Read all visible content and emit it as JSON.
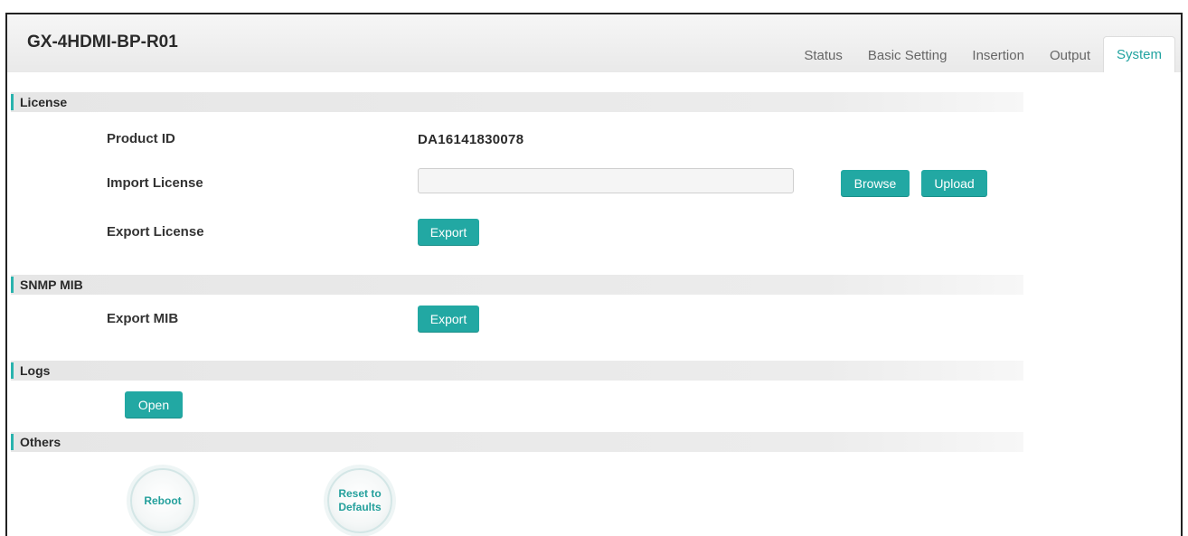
{
  "header": {
    "device_title": "GX-4HDMI-BP-R01",
    "tabs": [
      {
        "label": "Status",
        "active": false
      },
      {
        "label": "Basic Setting",
        "active": false
      },
      {
        "label": "Insertion",
        "active": false
      },
      {
        "label": "Output",
        "active": false
      },
      {
        "label": "System",
        "active": true
      }
    ]
  },
  "license": {
    "section_title": "License",
    "product_id_label": "Product ID",
    "product_id_value": "DA16141830078",
    "import_label": "Import License",
    "import_value": "",
    "browse_label": "Browse",
    "upload_label": "Upload",
    "export_label": "Export License",
    "export_button": "Export"
  },
  "snmp": {
    "section_title": "SNMP MIB",
    "export_mib_label": "Export MIB",
    "export_button": "Export"
  },
  "logs": {
    "section_title": "Logs",
    "open_button": "Open"
  },
  "others": {
    "section_title": "Others",
    "reboot_label": "Reboot",
    "reset_label_line1": "Reset to",
    "reset_label_line2": "Defaults"
  },
  "colors": {
    "accent": "#22a8a3",
    "active_tab_text": "#21a3a0"
  }
}
